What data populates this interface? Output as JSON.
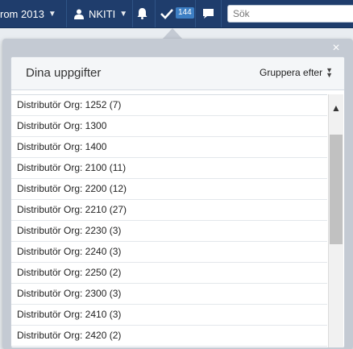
{
  "topbar": {
    "workspace_label": "rom 2013",
    "user_label": "NKITI",
    "tasks_count": "144",
    "search_placeholder": "Sök",
    "colors": {
      "bar": "#1f3d6c",
      "badge": "#3d7fc4"
    },
    "icons": [
      "chevron-down-icon",
      "user-icon",
      "bell-icon",
      "checkmark-icon",
      "chat-icon"
    ]
  },
  "panel": {
    "title": "Dina uppgifter",
    "group_by_label": "Gruppera efter",
    "close_symbol": "×",
    "items": [
      "Distributör Org: 1252 (7)",
      "Distributör Org: 1300",
      "Distributör Org: 1400",
      "Distributör Org: 2100 (11)",
      "Distributör Org: 2200 (12)",
      "Distributör Org: 2210 (27)",
      "Distributör Org: 2230 (3)",
      "Distributör Org: 2240 (3)",
      "Distributör Org: 2250 (2)",
      "Distributör Org: 2300 (3)",
      "Distributör Org: 2410 (3)",
      "Distributör Org: 2420 (2)"
    ]
  }
}
